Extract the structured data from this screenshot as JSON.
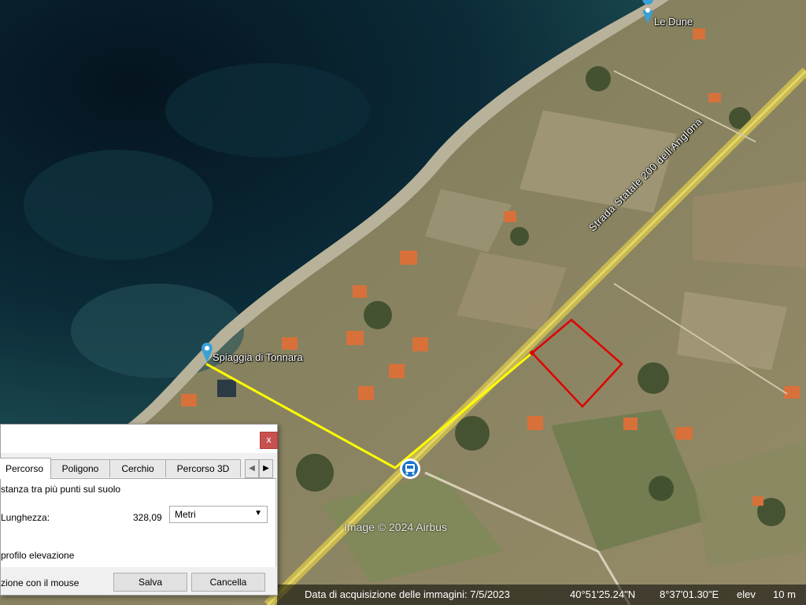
{
  "map": {
    "labels": {
      "le_dune": "Le Dune",
      "spiaggia": "Spiaggia di  Tonnara",
      "road": "Strada Statale 200 dell'Anglona"
    },
    "watermark": "Image © 2024 Airbus",
    "status": {
      "acquisition": "Data di acquisizione delle immagini: 7/5/2023",
      "lat": "40°51'25.24\"N",
      "lon": "8°37'01.30\"E",
      "elev_label": "elev",
      "elev_value": "10 m"
    },
    "colors": {
      "sea_deep": "#06202e",
      "sea_shallow": "#1d4a52",
      "beach": "#b8b29a",
      "land": "#8a8a62",
      "road": "#c8b850",
      "path": "#ffff00",
      "polygon": "#e00000"
    },
    "icons": [
      "place-pin-icon",
      "place-pin-icon",
      "bus-stop-icon"
    ]
  },
  "dialog": {
    "close_label": "x",
    "tabs": [
      "Percorso",
      "Poligono",
      "Cerchio",
      "Percorso 3D"
    ],
    "active_tab": "Percorso",
    "description": "stanza tra più punti sul suolo",
    "length_label": "Lunghezza:",
    "length_value": "328,09",
    "unit_selected": "Metri",
    "elevation_profile": "profilo elevazione",
    "mouse_nav": "zione con il mouse",
    "save_label": "Salva",
    "cancel_label": "Cancella"
  }
}
